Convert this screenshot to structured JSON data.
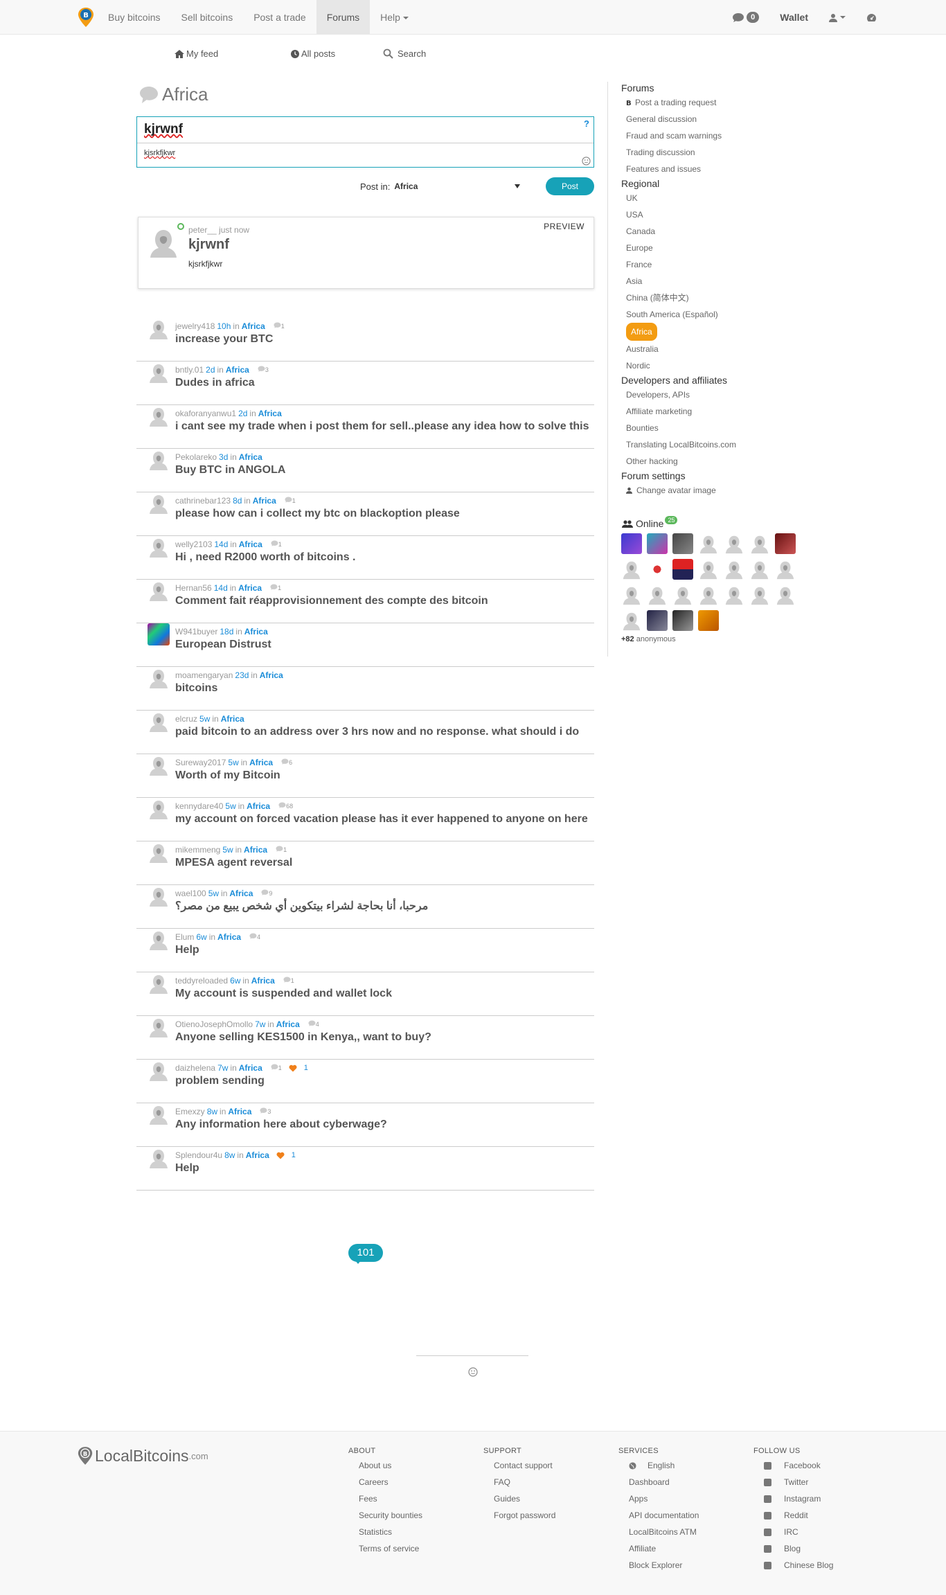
{
  "nav": {
    "items": [
      {
        "label": "Buy bitcoins",
        "name": "nav-buy-bitcoins"
      },
      {
        "label": "Sell bitcoins",
        "name": "nav-sell-bitcoins"
      },
      {
        "label": "Post a trade",
        "name": "nav-post-a-trade"
      },
      {
        "label": "Forums",
        "name": "nav-forums",
        "active": true
      },
      {
        "label": "Help",
        "name": "nav-help",
        "dropdown": true
      }
    ],
    "messages_count": "0",
    "wallet_label": "Wallet"
  },
  "subnav": {
    "my_feed": "My feed",
    "all_posts": "All posts",
    "search": "Search"
  },
  "forum": {
    "title": "Africa"
  },
  "compose": {
    "subject": "kjrwnf",
    "body": "kjsrkfjkwr",
    "help": "?",
    "post_in_label": "Post in:",
    "post_in_value": "Africa",
    "post_button": "Post"
  },
  "preview": {
    "label": "PREVIEW",
    "author": "peter__",
    "time": "just now",
    "title": "kjrwnf",
    "body": "kjsrkfjkwr"
  },
  "threads": [
    {
      "author": "jewelry418",
      "age": "10h",
      "in": "in",
      "forum": "Africa",
      "comments": "1",
      "title": "increase your BTC"
    },
    {
      "author": "bntly.01",
      "age": "2d",
      "in": "in",
      "forum": "Africa",
      "comments": "3",
      "title": "Dudes in africa"
    },
    {
      "author": "okaforanyanwu1",
      "age": "2d",
      "in": "in",
      "forum": "Africa",
      "title": "i cant see my trade when i post them for sell..please any idea how to solve this"
    },
    {
      "author": "Pekolareko",
      "age": "3d",
      "in": "in",
      "forum": "Africa",
      "title": "Buy BTC in ANGOLA"
    },
    {
      "author": "cathrinebar123",
      "age": "8d",
      "in": "in",
      "forum": "Africa",
      "comments": "1",
      "title": "please how can i collect my btc on blackoption please"
    },
    {
      "author": "welly2103",
      "age": "14d",
      "in": "in",
      "forum": "Africa",
      "comments": "1",
      "title": "Hi , need R2000 worth of bitcoins ."
    },
    {
      "author": "Hernan56",
      "age": "14d",
      "in": "in",
      "forum": "Africa",
      "comments": "1",
      "title": "Comment fait réapprovisionnement des compte des bitcoin"
    },
    {
      "author": "W941buyer",
      "age": "18d",
      "in": "in",
      "forum": "Africa",
      "title": "European Distrust",
      "colorav": true
    },
    {
      "author": "moamengaryan",
      "age": "23d",
      "in": "in",
      "forum": "Africa",
      "title": "bitcoins"
    },
    {
      "author": "elcruz",
      "age": "5w",
      "in": "in",
      "forum": "Africa",
      "title": "paid bitcoin to an address over 3 hrs now and no response. what should i do"
    },
    {
      "author": "Sureway2017",
      "age": "5w",
      "in": "in",
      "forum": "Africa",
      "comments": "6",
      "title": "Worth of my Bitcoin"
    },
    {
      "author": "kennydare40",
      "age": "5w",
      "in": "in",
      "forum": "Africa",
      "comments": "68",
      "title": "my account on forced vacation please has it ever happened to anyone on here"
    },
    {
      "author": "mikemmeng",
      "age": "5w",
      "in": "in",
      "forum": "Africa",
      "comments": "1",
      "title": "MPESA agent reversal"
    },
    {
      "author": "wael100",
      "age": "5w",
      "in": "in",
      "forum": "Africa",
      "comments": "9",
      "title": "مرحبا، أنا بحاجة لشراء بيتكوين أي شخص يبيع من مصر؟",
      "arabic": true
    },
    {
      "author": "Elum",
      "age": "6w",
      "in": "in",
      "forum": "Africa",
      "comments": "4",
      "title": "Help"
    },
    {
      "author": "teddyreloaded",
      "age": "6w",
      "in": "in",
      "forum": "Africa",
      "comments": "1",
      "title": "My account is suspended and wallet lock"
    },
    {
      "author": "OtienoJosephOmollo",
      "age": "7w",
      "in": "in",
      "forum": "Africa",
      "comments": "4",
      "title": "Anyone selling KES1500 in Kenya,, want to buy?"
    },
    {
      "author": "daizhelena",
      "age": "7w",
      "in": "in",
      "forum": "Africa",
      "comments": "1",
      "likes": "1",
      "title": "problem sending"
    },
    {
      "author": "Emexzy",
      "age": "8w",
      "in": "in",
      "forum": "Africa",
      "comments": "3",
      "title": "Any information here about cyberwage?"
    },
    {
      "author": "Splendour4u",
      "age": "8w",
      "in": "in",
      "forum": "Africa",
      "likes": "1",
      "title": "Help"
    }
  ],
  "pager": {
    "label": "101"
  },
  "sidebar": {
    "forums_heading": "Forums",
    "forums": [
      "Post a trading request",
      "General discussion",
      "Fraud and scam warnings",
      "Trading discussion",
      "Features and issues"
    ],
    "regional_heading": "Regional",
    "regional": [
      "UK",
      "USA",
      "Canada",
      "Europe",
      "France",
      "Asia",
      "China (简体中文)",
      "South America (Español)",
      "Africa",
      "Australia",
      "Nordic"
    ],
    "regional_active": "Africa",
    "dev_heading": "Developers and affiliates",
    "dev": [
      "Developers, APIs",
      "Affiliate marketing",
      "Bounties",
      "Translating LocalBitcoins.com",
      "Other hacking"
    ],
    "settings_heading": "Forum settings",
    "settings": [
      "Change avatar image"
    ],
    "online_label": "Online",
    "online_count": "25",
    "anon_count": "+82",
    "anon_label": "anonymous"
  },
  "footer": {
    "logo_text": "LocalBitcoins",
    "logo_suffix": ".com",
    "about_heading": "ABOUT",
    "about": [
      "About us",
      "Careers",
      "Fees",
      "Security bounties",
      "Statistics",
      "Terms of service"
    ],
    "support_heading": "SUPPORT",
    "support": [
      "Contact support",
      "FAQ",
      "Guides",
      "Forgot password"
    ],
    "services_heading": "SERVICES",
    "services": [
      "English",
      "Dashboard",
      "Apps",
      "API documentation",
      "LocalBitcoins ATM",
      "Affiliate",
      "Block Explorer"
    ],
    "follow_heading": "FOLLOW US",
    "follow": [
      {
        "label": "Facebook",
        "icon": "facebook-icon"
      },
      {
        "label": "Twitter",
        "icon": "twitter-icon"
      },
      {
        "label": "Instagram",
        "icon": "instagram-icon"
      },
      {
        "label": "Reddit",
        "icon": "reddit-icon"
      },
      {
        "label": "IRC",
        "icon": "hashtag-icon"
      },
      {
        "label": "Blog",
        "icon": "rss-icon"
      },
      {
        "label": "Chinese Blog",
        "icon": "weibo-icon"
      }
    ]
  },
  "colors": {
    "accent": "#17a2b8",
    "link": "#1a8cd8",
    "active_forum": "#f39c12",
    "online": "#5cb85c"
  }
}
